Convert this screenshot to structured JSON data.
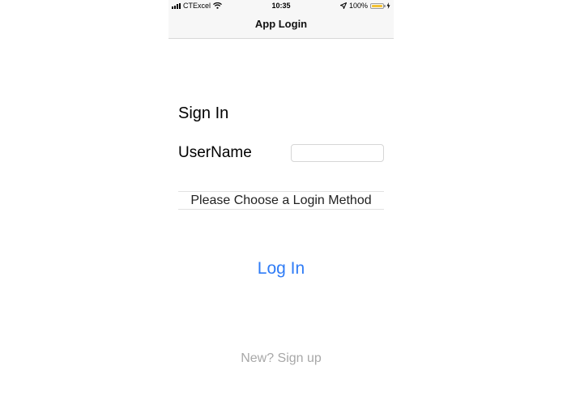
{
  "status_bar": {
    "carrier": "CTExcel",
    "time": "10:35",
    "battery_percent": "100%",
    "battery_level": 1.0,
    "battery_color": "#f2c233",
    "signal_icon": "cellular-signal-icon",
    "wifi_icon": "wifi-icon",
    "location_icon": "location-arrow-icon",
    "charging_icon": "charging-bolt-icon"
  },
  "nav_bar": {
    "title": "App Login"
  },
  "form": {
    "heading": "Sign In",
    "username_label": "UserName",
    "username_value": "",
    "username_placeholder": "",
    "method_picker_label": "Please Choose a Login Method"
  },
  "actions": {
    "login_label": "Log In",
    "login_color": "#2f7cf6",
    "signup_label": "New? Sign up"
  }
}
